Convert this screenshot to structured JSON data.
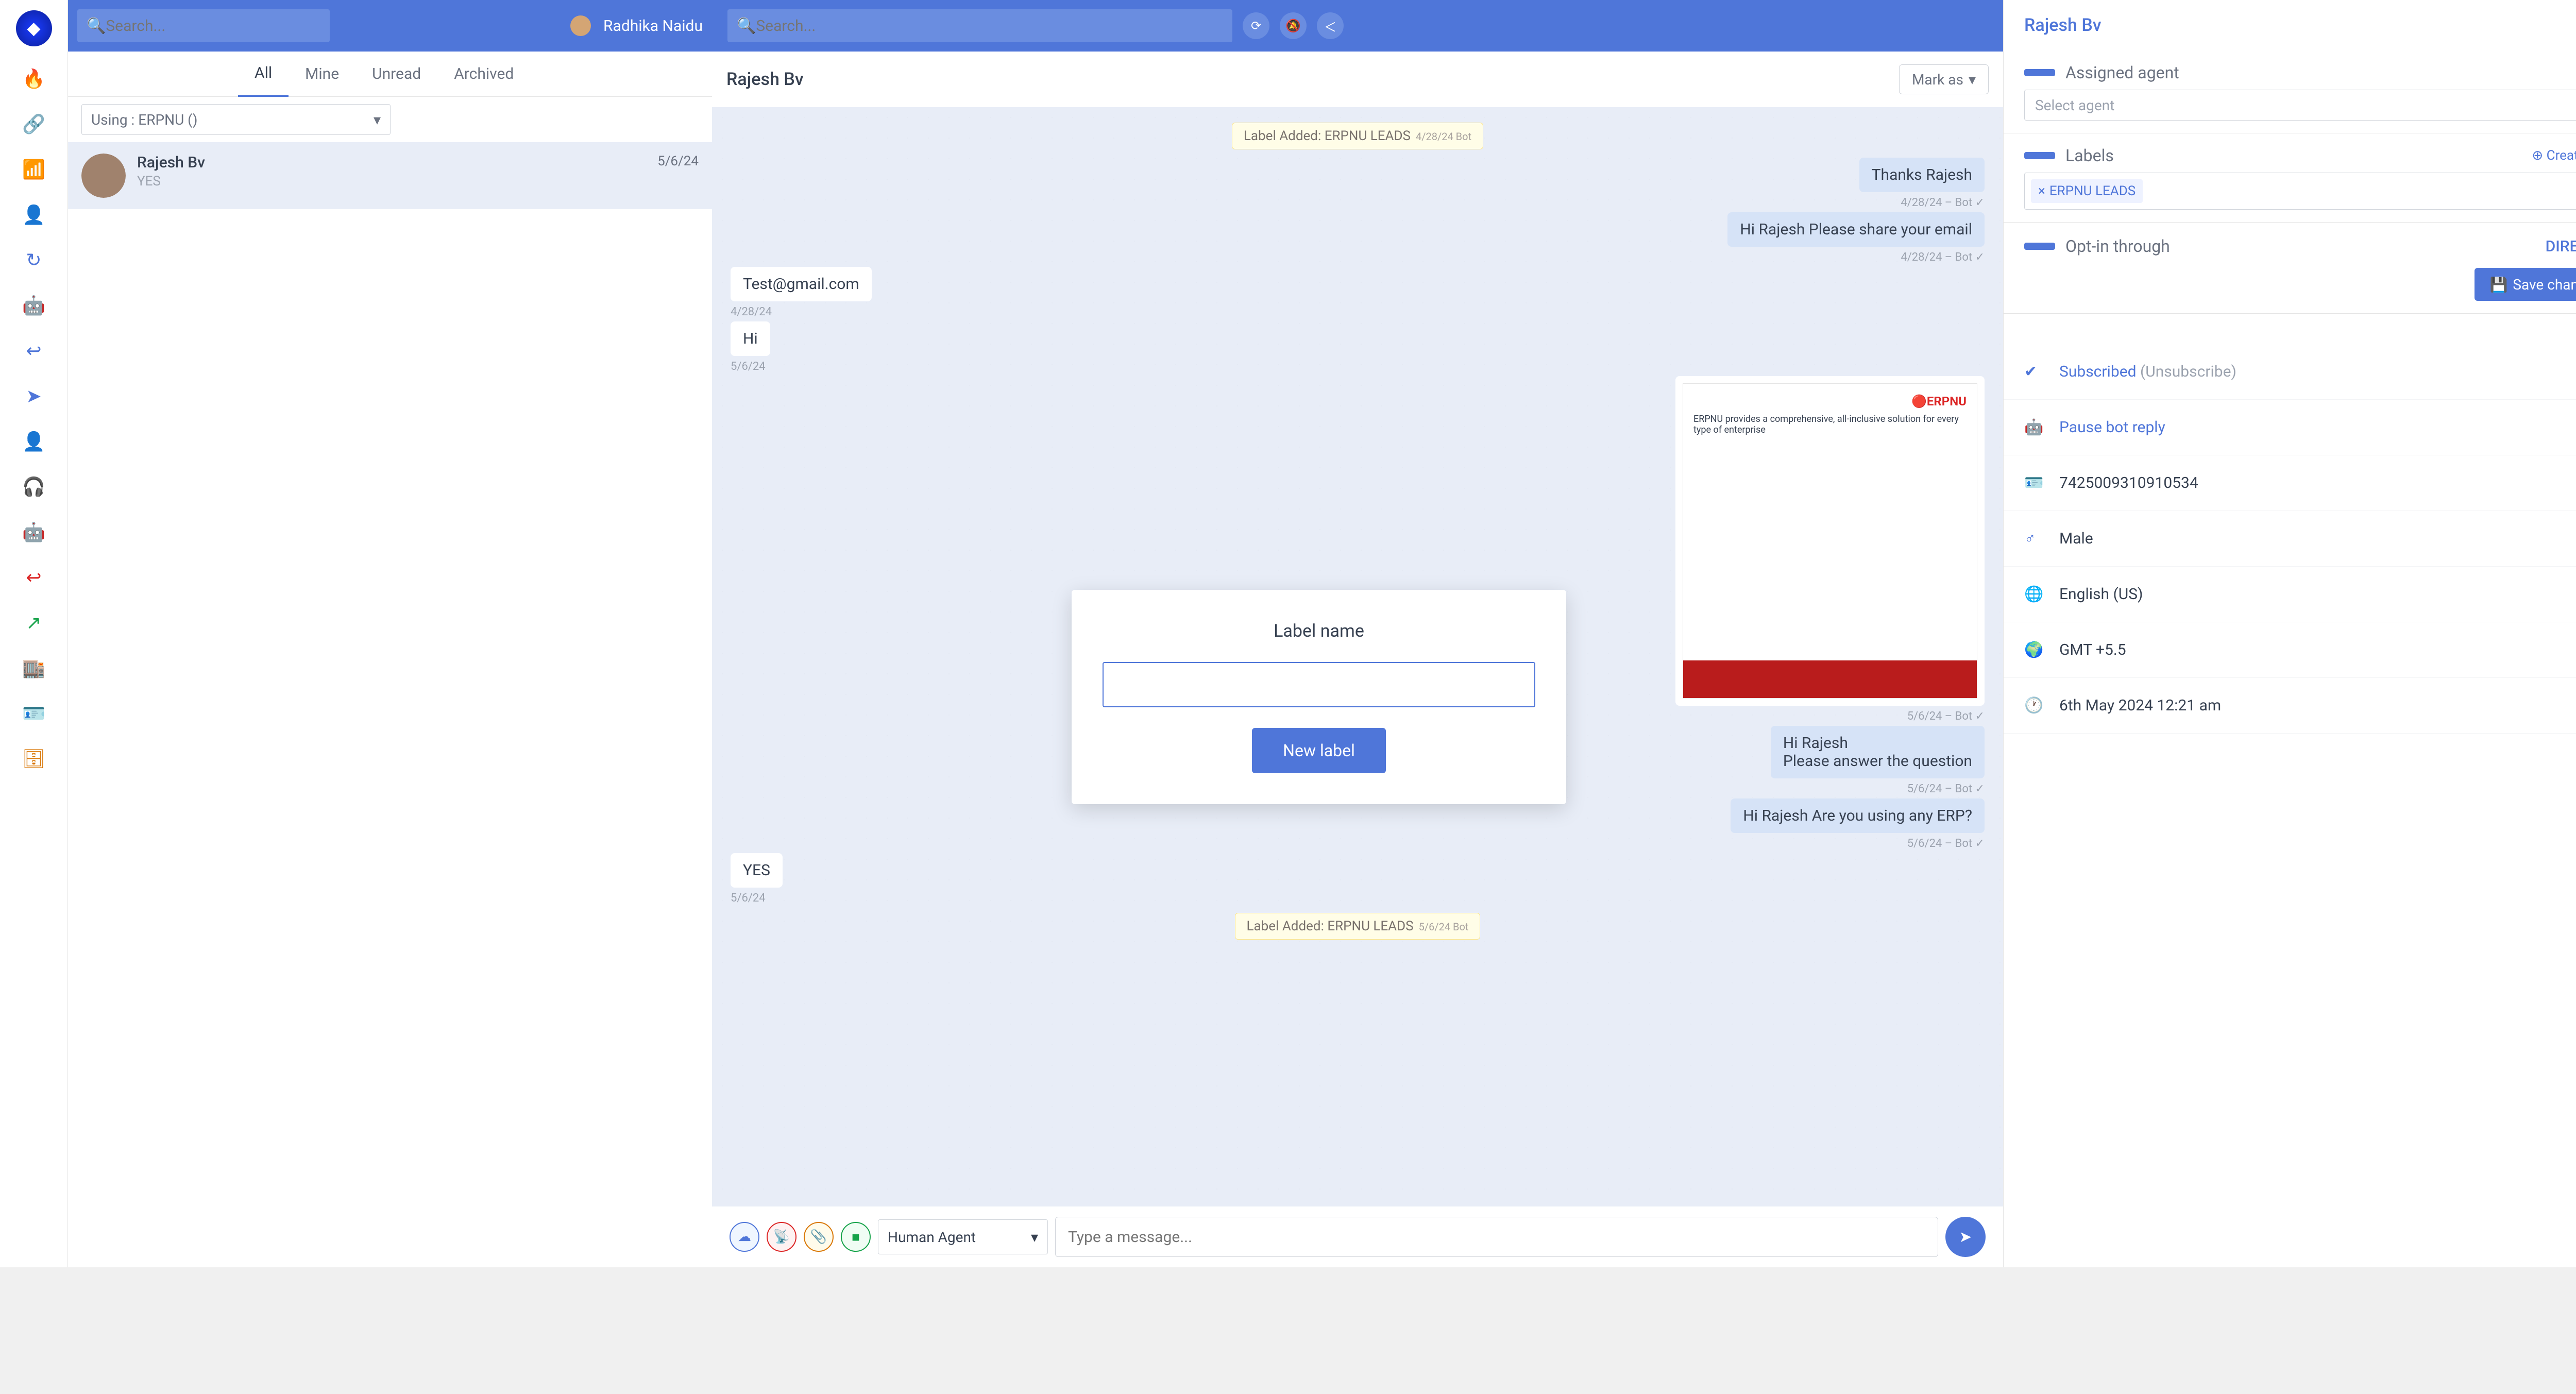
{
  "sidebar": {
    "icons": [
      "fire",
      "link",
      "wifi",
      "user",
      "refresh",
      "bot",
      "reply",
      "send",
      "user2",
      "speaker",
      "bot2",
      "reply2",
      "export",
      "store",
      "contacts",
      "db"
    ]
  },
  "topbar": {
    "search1_placeholder": "Search...",
    "user_name": "Radhika Naidu",
    "search2_placeholder": "Search..."
  },
  "tabs": {
    "all": "All",
    "mine": "Mine",
    "unread": "Unread",
    "archived": "Archived"
  },
  "filter": {
    "label": "Using : ERPNU ()"
  },
  "conv": {
    "items": [
      {
        "name": "Rajesh Bv",
        "date": "5/6/24",
        "preview": "YES"
      }
    ]
  },
  "chat": {
    "name": "Rajesh Bv",
    "mark_as": "Mark as",
    "syslabel1": "Label Added: ERPNU LEADS",
    "syslabel1_meta": "4/28/24  Bot",
    "m1": "Thanks Rajesh",
    "m1_meta": "4/28/24  – Bot ✓",
    "m2": "Hi Rajesh Please share your email",
    "m2_meta": "4/28/24  – Bot ✓",
    "m3": "Test@gmail.com",
    "m3_meta": "4/28/24",
    "m4": "Hi",
    "m4_meta": "5/6/24",
    "erp_logo": "🔴ERPNU",
    "erp_headline": "ERPNU provides a comprehensive, all-inclusive solution for every type of enterprise",
    "img_meta": "5/6/24  – Bot ✓",
    "m5_l1": "Hi Rajesh",
    "m5_l2": "Please answer the question",
    "m5_meta": "5/6/24  – Bot ✓",
    "m6": "Hi Rajesh Are you using any ERP?",
    "m6_meta": "5/6/24  – Bot ✓",
    "m7": "YES",
    "m7_meta": "5/6/24",
    "syslabel2": "Label Added: ERPNU LEADS",
    "syslabel2_meta": "5/6/24  Bot"
  },
  "composer": {
    "agent_mode": "Human Agent",
    "placeholder": "Type a message..."
  },
  "detail": {
    "name": "Rajesh Bv",
    "assigned_title": "Assigned agent",
    "select_agent": "Select agent",
    "labels_title": "Labels",
    "create_label": "⊕ Create label",
    "chip": "ERPNU LEADS",
    "optin_title": "Opt-in through",
    "direct": "DIRECT",
    "save_btn": "Save changes",
    "subscribed": "Subscribed",
    "unsubscribe": "(Unsubscribe)",
    "pause_bot": "Pause bot reply",
    "phone": "7425009310910534",
    "gender": "Male",
    "lang": "English (US)",
    "tz": "GMT +5.5",
    "created": "6th May 2024 12:21 am"
  },
  "modal": {
    "title": "Label name",
    "button": "New label"
  }
}
